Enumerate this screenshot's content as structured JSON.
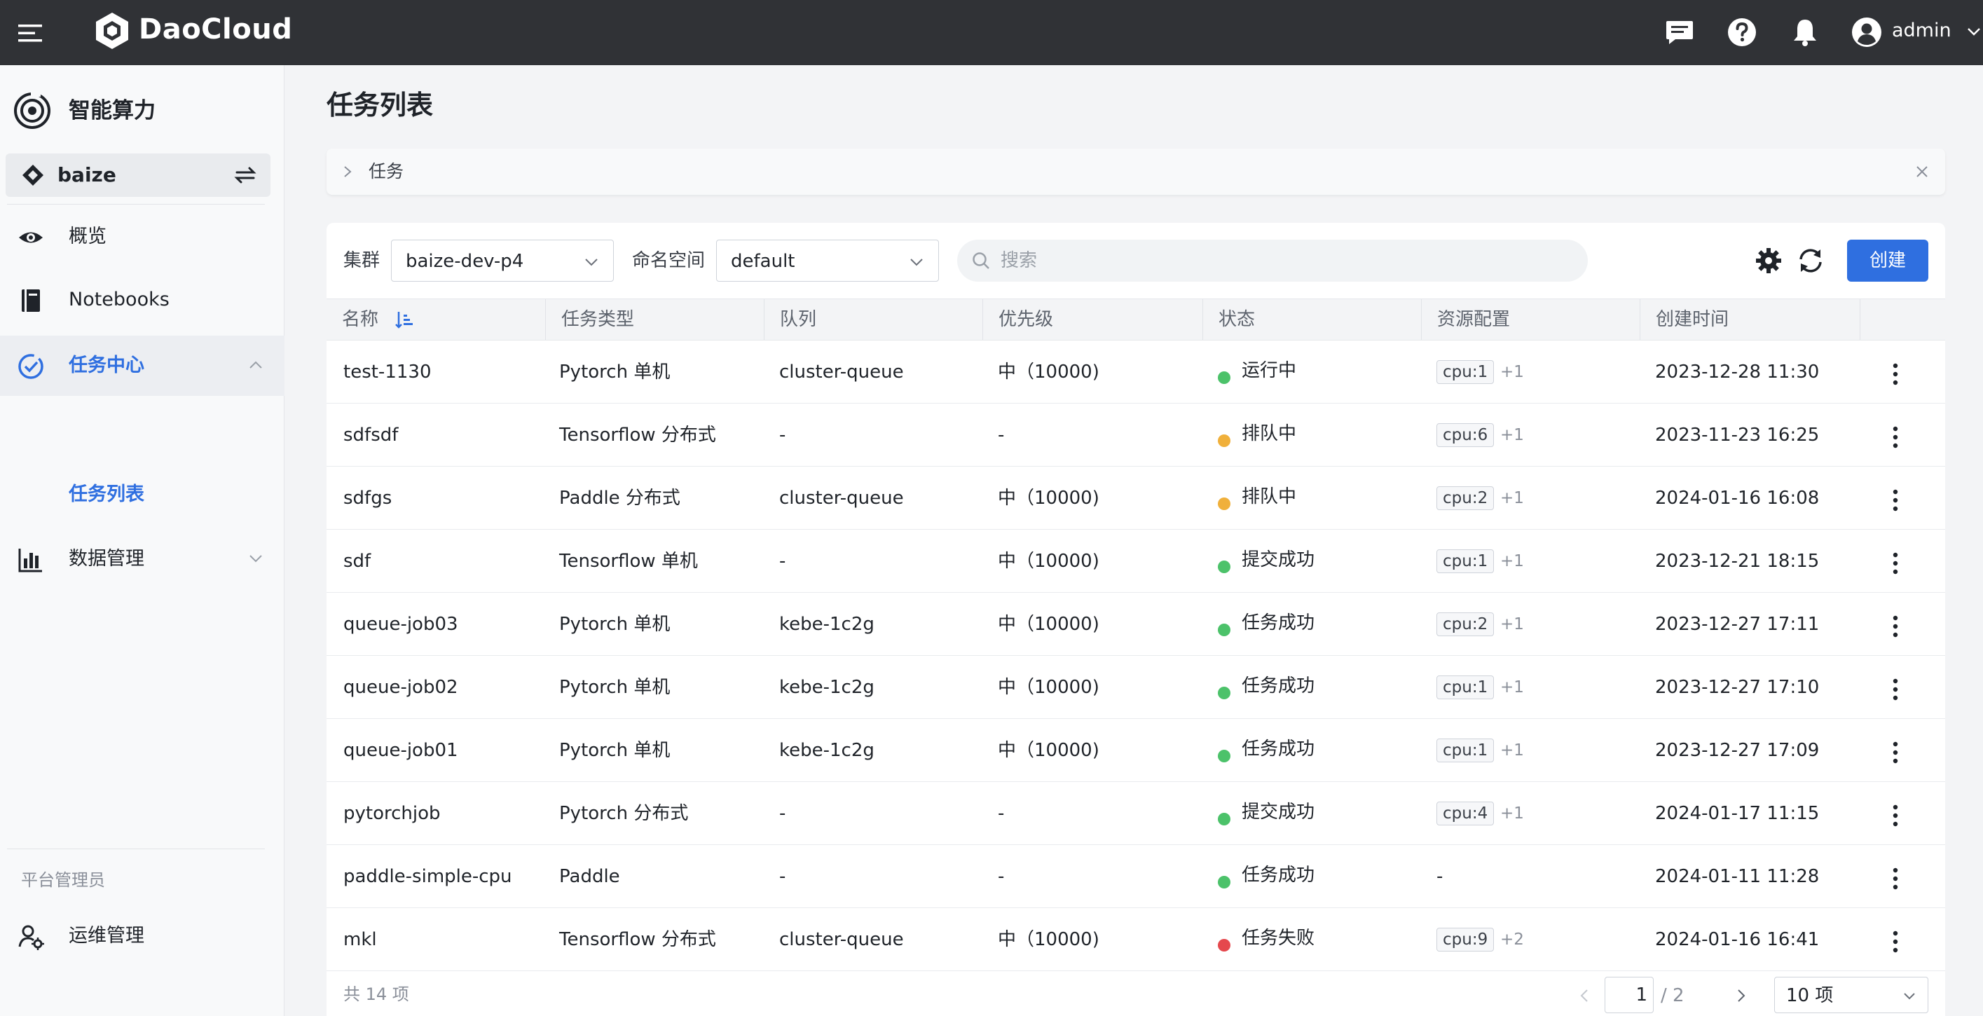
{
  "topbar": {
    "brand": "DaoCloud",
    "user": "admin"
  },
  "sidebar": {
    "app_title": "智能算力",
    "workspace": "baize",
    "items": [
      {
        "label": "概览"
      },
      {
        "label": "Notebooks"
      },
      {
        "label": "任务中心"
      },
      {
        "label": "任务列表"
      },
      {
        "label": "数据管理"
      }
    ],
    "section_label": "平台管理员",
    "admin_item": "运维管理"
  },
  "page": {
    "title": "任务列表",
    "breadcrumb": "任务"
  },
  "toolbar": {
    "cluster_label": "集群",
    "cluster_value": "baize-dev-p4",
    "namespace_label": "命名空间",
    "namespace_value": "default",
    "search_placeholder": "搜索",
    "create_label": "创建"
  },
  "table": {
    "headers": [
      "名称",
      "任务类型",
      "队列",
      "优先级",
      "状态",
      "资源配置",
      "创建时间"
    ],
    "rows": [
      {
        "name": "test-1130",
        "type": "Pytorch 单机",
        "queue": "cluster-queue",
        "priority": "中（10000)",
        "status": "运行中",
        "status_color": "#4cc26a",
        "res": "cpu:1",
        "res_more": "+1",
        "created": "2023-12-28 11:30"
      },
      {
        "name": "sdfsdf",
        "type": "Tensorflow 分布式",
        "queue": "-",
        "priority": "-",
        "status": "排队中",
        "status_color": "#f0b03b",
        "res": "cpu:6",
        "res_more": "+1",
        "created": "2023-11-23 16:25"
      },
      {
        "name": "sdfgs",
        "type": "Paddle 分布式",
        "queue": "cluster-queue",
        "priority": "中（10000)",
        "status": "排队中",
        "status_color": "#f0b03b",
        "res": "cpu:2",
        "res_more": "+1",
        "created": "2024-01-16 16:08"
      },
      {
        "name": "sdf",
        "type": "Tensorflow 单机",
        "queue": "-",
        "priority": "中（10000)",
        "status": "提交成功",
        "status_color": "#4cc26a",
        "res": "cpu:1",
        "res_more": "+1",
        "created": "2023-12-21 18:15"
      },
      {
        "name": "queue-job03",
        "type": "Pytorch 单机",
        "queue": "kebe-1c2g",
        "priority": "中（10000)",
        "status": "任务成功",
        "status_color": "#4cc26a",
        "res": "cpu:2",
        "res_more": "+1",
        "created": "2023-12-27 17:11"
      },
      {
        "name": "queue-job02",
        "type": "Pytorch 单机",
        "queue": "kebe-1c2g",
        "priority": "中（10000)",
        "status": "任务成功",
        "status_color": "#4cc26a",
        "res": "cpu:1",
        "res_more": "+1",
        "created": "2023-12-27 17:10"
      },
      {
        "name": "queue-job01",
        "type": "Pytorch 单机",
        "queue": "kebe-1c2g",
        "priority": "中（10000)",
        "status": "任务成功",
        "status_color": "#4cc26a",
        "res": "cpu:1",
        "res_more": "+1",
        "created": "2023-12-27 17:09"
      },
      {
        "name": "pytorchjob",
        "type": "Pytorch 分布式",
        "queue": "-",
        "priority": "-",
        "status": "提交成功",
        "status_color": "#4cc26a",
        "res": "cpu:4",
        "res_more": "+1",
        "created": "2024-01-17 11:15"
      },
      {
        "name": "paddle-simple-cpu",
        "type": "Paddle",
        "queue": "-",
        "priority": "-",
        "status": "任务成功",
        "status_color": "#4cc26a",
        "res": "-",
        "res_more": "",
        "created": "2024-01-11 11:28"
      },
      {
        "name": "mkl",
        "type": "Tensorflow 分布式",
        "queue": "cluster-queue",
        "priority": "中（10000)",
        "status": "任务失败",
        "status_color": "#e5484d",
        "res": "cpu:9",
        "res_more": "+2",
        "created": "2024-01-16 16:41"
      }
    ]
  },
  "pagination": {
    "total": "共 14 项",
    "current": "1",
    "pages": "/ 2",
    "page_size": "10 项"
  },
  "colors": {
    "accent": "#2f6fe0",
    "topbar": "#303236",
    "running": "#4cc26a",
    "queued": "#f0b03b",
    "failed": "#e5484d"
  }
}
